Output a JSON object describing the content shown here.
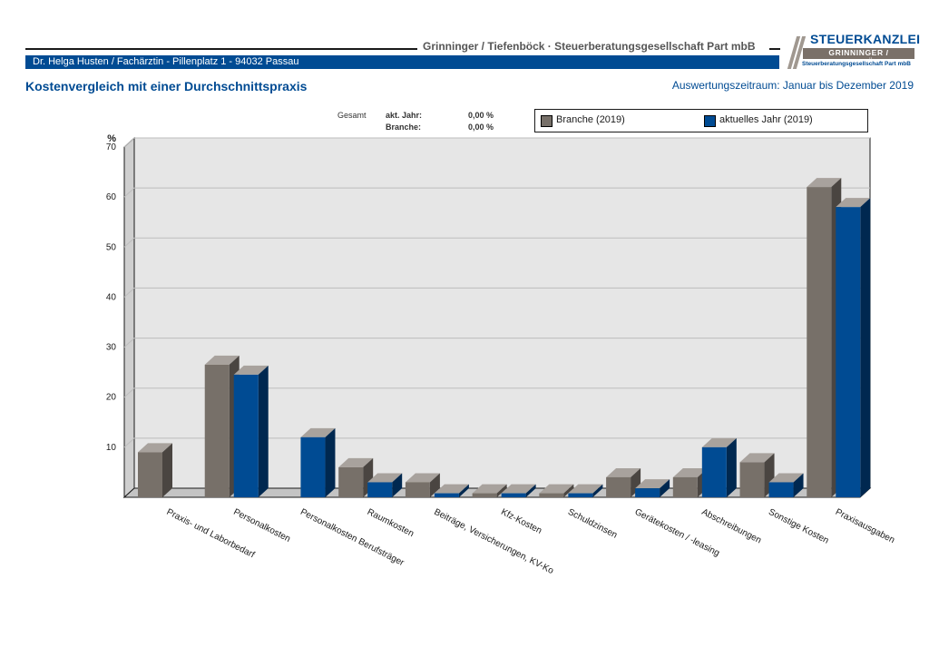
{
  "header": {
    "firm_name": "Grinninger / Tiefenböck · Steuerberatungsgesellschaft Part mbB",
    "client": "Dr. Helga Husten / Fachärztin  -  Pillenplatz 1  -  94032 Passau",
    "logo_top": "STEUERKANZLEI",
    "logo_mid": "GRINNINGER / TIEFENBÖCK",
    "logo_bottom": "Steuerberatungsgesellschaft Part mbB",
    "title": "Kostenvergleich mit einer Durchschnittspraxis",
    "period": "Auswertungszeitraum: Januar bis Dezember 2019"
  },
  "summary": {
    "label": "Gesamt",
    "row1_label": "akt. Jahr:",
    "row1_value": "0,00 %",
    "row2_label": "Branche:",
    "row2_value": "0,00 %"
  },
  "legend": [
    {
      "label": "Branche (2019)"
    },
    {
      "label": "aktuelles Jahr (2019)"
    }
  ],
  "colors": {
    "branche_front": "#777069",
    "branche_top": "#a8a29d",
    "branche_side": "#4a4541",
    "aktuell_front": "#004b93",
    "aktuell_top": "#a8a29d",
    "aktuell_side": "#002850",
    "accent": "#004b93"
  },
  "chart_data": {
    "type": "bar",
    "ylabel": "%",
    "ylim": [
      0,
      70
    ],
    "yticks": [
      "70",
      "60",
      "50",
      "40",
      "30",
      "20",
      "10"
    ],
    "categories": [
      "Praxis- und Laborbedarf",
      "Personalkosten",
      "Personalkosten Berufsträger",
      "Raumkosten",
      "Beiträge, Versicherungen, KV-Ko",
      "Kfz-Kosten",
      "Schuldzinsen",
      "Gerätekosten / -leasing",
      "Abschreibungen",
      "Sonstige Kosten",
      "Praxisausgaben"
    ],
    "series": [
      {
        "name": "Branche (2019)",
        "values": [
          9,
          26.5,
          0,
          6,
          3,
          0.8,
          0.8,
          4,
          4,
          7,
          62
        ]
      },
      {
        "name": "aktuelles Jahr (2019)",
        "values": [
          0,
          24.5,
          12,
          3,
          0.8,
          0.8,
          0.8,
          1.8,
          10,
          3,
          58
        ]
      }
    ],
    "grid": true,
    "legend_position": "top-right"
  }
}
